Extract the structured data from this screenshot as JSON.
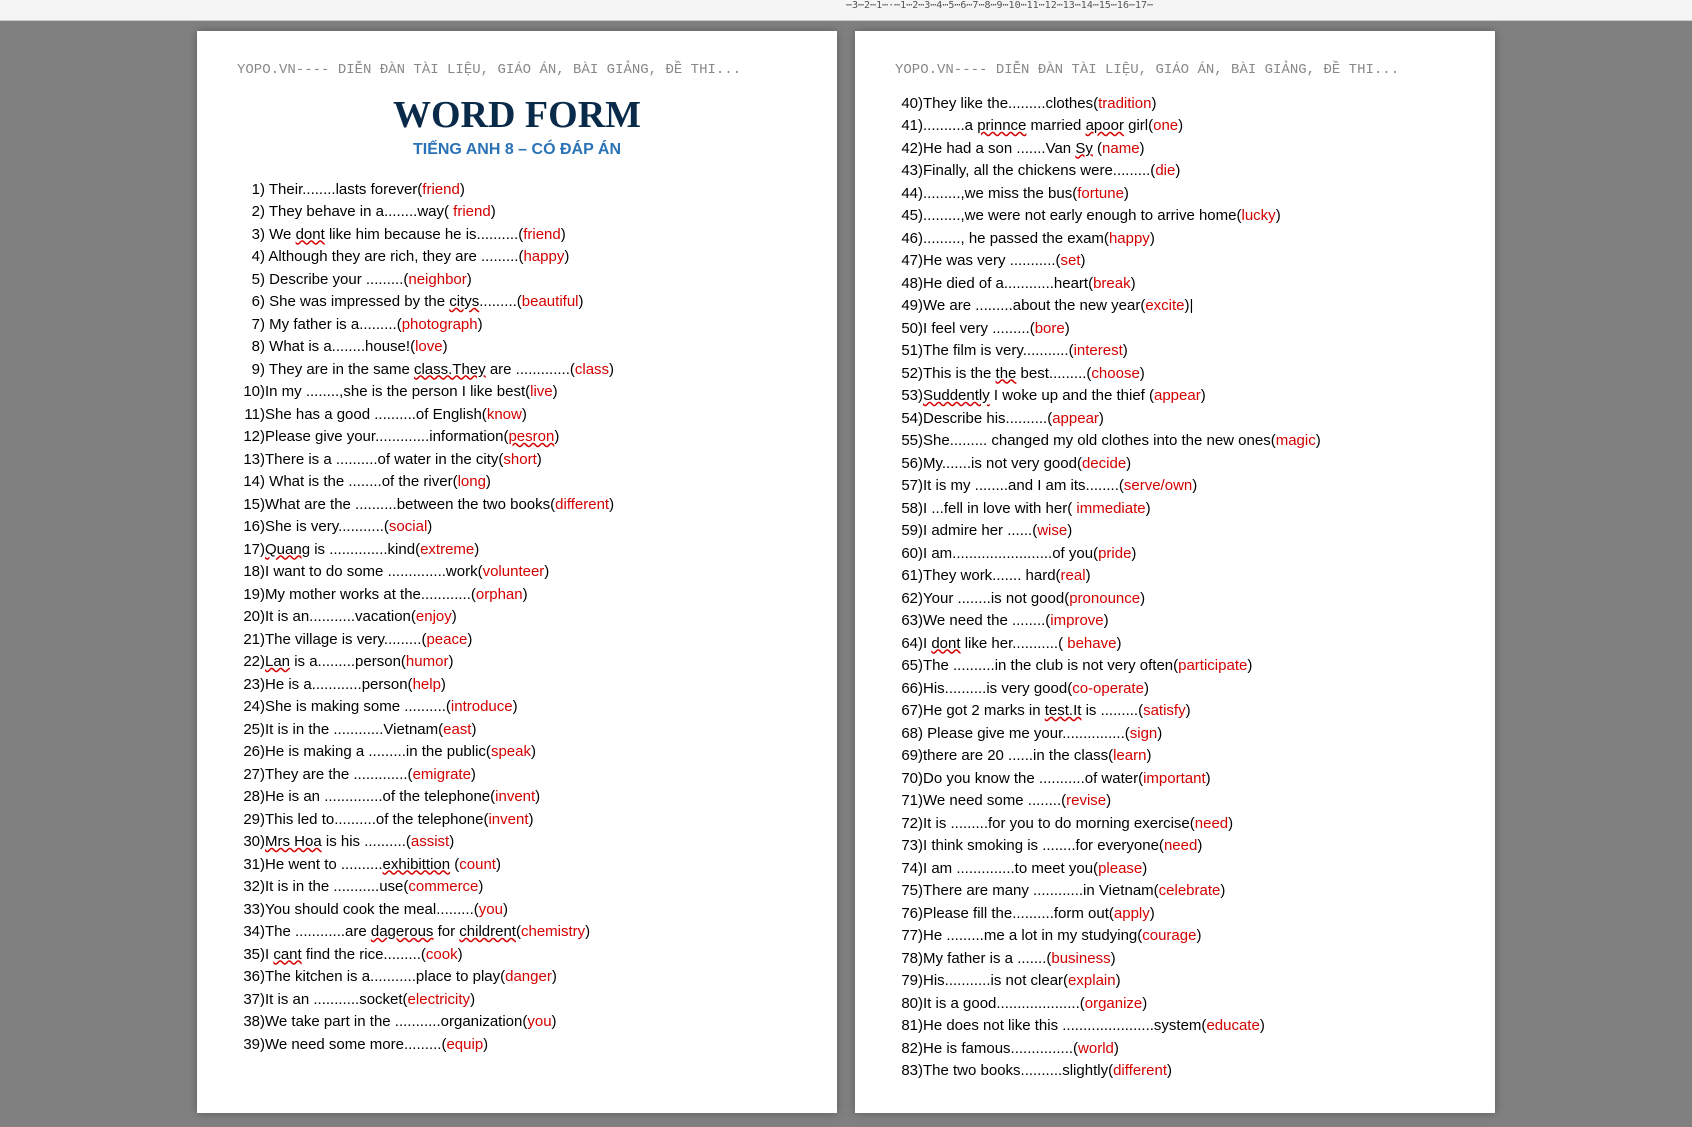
{
  "ruler_text": "⋯3⋯2⋯1⋯·⋯1⋯2⋯3⋯4⋯5⋯6⋯7⋯8⋯9⋯10⋯11⋯12⋯13⋯14⋯15⋯16⋯17⋯",
  "header": "YOPO.VN---- DIỄN ĐÀN TÀI LIỆU, GIÁO ÁN, BÀI GIẢNG, ĐỀ THI...",
  "title": "WORD FORM",
  "subtitle": "TIẾNG ANH 8 – CÓ ĐÁP ÁN",
  "page1_start": 1,
  "page1_items": [
    {
      "pre": " Their........lasts forever(",
      "ans": "friend",
      "post": ")",
      "wavy": []
    },
    {
      "pre": " They behave in a........way( ",
      "ans": "friend",
      "post": ")",
      "wavy": []
    },
    {
      "pre": " We ",
      "w": "dont",
      "pre2": " like  him because he is..........(",
      "ans": "friend",
      "post": ")",
      "wavy": [
        "dont"
      ]
    },
    {
      "pre": " Although they are rich, they are .........(",
      "ans": "happy",
      "post": ")",
      "wavy": []
    },
    {
      "pre": " Describe your .........(",
      "ans": "neighbor",
      "post": ")",
      "wavy": []
    },
    {
      "pre": " She was impressed by the ",
      "w": "citys",
      "pre2": ".........(",
      "ans": "beautiful",
      "post": ")",
      "wavy": [
        "citys"
      ]
    },
    {
      "pre": " My father is a.........(",
      "ans": "photograph",
      "post": ")",
      "wavy": []
    },
    {
      "pre": " What is a........house!(",
      "ans": "love",
      "post": ")",
      "wavy": []
    },
    {
      "pre": " They are in the same ",
      "w": "class.They",
      "pre2": " are .............(",
      "ans": "class",
      "post": ")",
      "wavy": [
        "class.They"
      ]
    },
    {
      "pre": "In my ........,she is the person I like best(",
      "ans": "live",
      "post": ")",
      "wavy": []
    },
    {
      "pre": "She has a good ..........of English(",
      "ans": "know",
      "post": ")",
      "wavy": []
    },
    {
      "pre": "Please give your.............information(",
      "ans": "pesron",
      "post": ")",
      "wavy": [
        "pesron"
      ]
    },
    {
      "pre": "There is a ..........of water in the city(",
      "ans": "short",
      "post": ")",
      "wavy": []
    },
    {
      "pre": " What is the ........of the river(",
      "ans": "long",
      "post": ")",
      "wavy": []
    },
    {
      "pre": "What are the ..........between the two books(",
      "ans": "different",
      "post": ")",
      "wavy": []
    },
    {
      "pre": "She is very...........(",
      "ans": "social",
      "post": ")",
      "wavy": []
    },
    {
      "pre": "",
      "w": "Quang",
      "pre2": " is ..............kind(",
      "ans": "extreme",
      "post": ")",
      "wavy": [
        "Quang"
      ]
    },
    {
      "pre": "I want to do some ..............work(",
      "ans": "volunteer",
      "post": ")",
      "wavy": []
    },
    {
      "pre": "My mother works at the............(",
      "ans": "orphan",
      "post": ")",
      "wavy": []
    },
    {
      "pre": "It is an...........vacation(",
      "ans": "enjoy",
      "post": ")",
      "wavy": []
    },
    {
      "pre": "The village is very.........(",
      "ans": "peace",
      "post": ")",
      "wavy": []
    },
    {
      "pre": "",
      "w": "Lan",
      "pre2": " is a.........person(",
      "ans": "humor",
      "post": ")",
      "wavy": [
        "Lan"
      ]
    },
    {
      "pre": "He is a............person(",
      "ans": "help",
      "post": ")",
      "wavy": []
    },
    {
      "pre": "She is making some ..........(",
      "ans": "introduce",
      "post": ")",
      "wavy": []
    },
    {
      "pre": "It is in the ............Vietnam(",
      "ans": "east",
      "post": ")",
      "wavy": []
    },
    {
      "pre": "He is making a .........in  the public(",
      "ans": "speak",
      "post": ")",
      "wavy": []
    },
    {
      "pre": "They are  the .............(",
      "ans": "emigrate",
      "post": ")",
      "wavy": []
    },
    {
      "pre": "He is an ..............of the telephone(",
      "ans": "invent",
      "post": ")",
      "wavy": []
    },
    {
      "pre": "This led  to..........of the telephone(",
      "ans": "invent",
      "post": ")",
      "wavy": []
    },
    {
      "pre": "",
      "w": "Mrs Hoa",
      "pre2": " is his ..........(",
      "ans": "assist",
      "post": ")",
      "wavy": [
        "Mrs Hoa"
      ]
    },
    {
      "pre": "He went to ..........",
      "w": "exhibittion",
      "pre2": " (",
      "ans": "count",
      "post": ")",
      "wavy": [
        "exhibittion"
      ]
    },
    {
      "pre": "It is in the ...........use(",
      "ans": "commerce",
      "post": ")",
      "wavy": []
    },
    {
      "pre": "You should cook the meal.........(",
      "ans": "you",
      "post": ")",
      "wavy": []
    },
    {
      "pre": "The ............are ",
      "w": "dagerous",
      "pre2": " for ",
      "w2": "childrent",
      "pre3": "(",
      "ans": "chemistry",
      "post": ")",
      "wavy": [
        "dagerous",
        "childrent"
      ]
    },
    {
      "pre": "I ",
      "w": "cant",
      "pre2": " find the rice.........(",
      "ans": "cook",
      "post": ")",
      "wavy": [
        "cant"
      ]
    },
    {
      "pre": "The kitchen is a...........place to play(",
      "ans": "danger",
      "post": ")",
      "wavy": []
    },
    {
      "pre": "It is an ...........socket(",
      "ans": "electricity",
      "post": ")",
      "wavy": []
    },
    {
      "pre": "We take part in the ...........organization(",
      "ans": "you",
      "post": ")",
      "wavy": []
    },
    {
      "pre": "We need some more.........(",
      "ans": "equip",
      "post": ")",
      "wavy": []
    }
  ],
  "page2_start": 40,
  "page2_items": [
    {
      "pre": "They like the.........clothes(",
      "ans": "tradition",
      "post": ")",
      "wavy": []
    },
    {
      "pre": "..........a ",
      "w": "prinnce",
      "pre2": " married ",
      "w2": "apoor",
      "pre3": " girl(",
      "ans": "one",
      "post": ")",
      "wavy": [
        "prinnce",
        "apoor"
      ]
    },
    {
      "pre": "He had a son .......Van ",
      "w": "Sy",
      "pre2": " (",
      "ans": "name",
      "post": ")",
      "wavy": [
        "Sy"
      ]
    },
    {
      "pre": "Finally, all the chickens were.........(",
      "ans": "die",
      "post": ")",
      "wavy": []
    },
    {
      "pre": ".........,we miss the bus(",
      "ans": "fortune",
      "post": ")",
      "wavy": []
    },
    {
      "pre": ".........,we were not early enough to arrive home(",
      "ans": "lucky",
      "post": ")",
      "wavy": []
    },
    {
      "pre": "........., he passed the exam(",
      "ans": "happy",
      "post": ")",
      "wavy": []
    },
    {
      "pre": "He was very ...........(",
      "ans": "set",
      "post": ")",
      "wavy": []
    },
    {
      "pre": "He died of a............heart(",
      "ans": "break",
      "post": ")",
      "wavy": []
    },
    {
      "pre": "We are .........about the new year(",
      "ans": "excite",
      "post": ")|",
      "wavy": []
    },
    {
      "pre": "I feel very .........(",
      "ans": "bore",
      "post": ")",
      "wavy": []
    },
    {
      "pre": "The film is very...........(",
      "ans": "interest",
      "post": ")",
      "wavy": []
    },
    {
      "pre": "This is the ",
      "w": "the",
      "pre2": " best.........(",
      "ans": "choose",
      "post": ")",
      "wavy": [
        "the"
      ]
    },
    {
      "pre": "",
      "w": "Suddently",
      "pre2": " I woke up and the thief (",
      "ans": "appear",
      "post": ")",
      "wavy": [
        "Suddently"
      ]
    },
    {
      "pre": "Describe his..........(",
      "ans": "appear",
      "post": ")",
      "wavy": []
    },
    {
      "pre": "She......... changed my old clothes into the new ones(",
      "ans": "magic",
      "post": ")",
      "wavy": []
    },
    {
      "pre": "My.......is not very good(",
      "ans": "decide",
      "post": ")",
      "wavy": []
    },
    {
      "pre": "It is my ........and I am its........(",
      "ans": "serve/own",
      "post": ")",
      "wavy": []
    },
    {
      "pre": "I ...fell in love with her( ",
      "ans": "immediate",
      "post": ")",
      "wavy": []
    },
    {
      "pre": "I admire her ......(",
      "ans": "wise",
      "post": ")",
      "wavy": []
    },
    {
      "pre": "I am........................of you(",
      "ans": "pride",
      "post": ")",
      "wavy": []
    },
    {
      "pre": "They work....... hard(",
      "ans": "real",
      "post": ")",
      "wavy": []
    },
    {
      "pre": "Your ........is not good(",
      "ans": "pronounce",
      "post": ")",
      "wavy": []
    },
    {
      "pre": "We need the ........(",
      "ans": "improve",
      "post": ")",
      "wavy": []
    },
    {
      "pre": "I ",
      "w": "dont",
      "pre2": " like her...........( ",
      "ans": "behave",
      "post": ")",
      "wavy": [
        "dont"
      ]
    },
    {
      "pre": "The ..........in the club is not very often(",
      "ans": "participate",
      "post": ")",
      "wavy": []
    },
    {
      "pre": "His..........is very good(",
      "ans": "co-operate",
      "post": ")",
      "wavy": []
    },
    {
      "pre": "He got 2 marks in ",
      "w": "test.It",
      "pre2": " is .........(",
      "ans": "satisfy",
      "post": ")",
      "wavy": [
        "test.It"
      ]
    },
    {
      "pre": " Please give me your...............(",
      "ans": "sign",
      "post": ")",
      "wavy": []
    },
    {
      "pre": "there are 20 ......in the class(",
      "ans": "learn",
      "post": ")",
      "wavy": []
    },
    {
      "pre": "Do you know the ...........of water(",
      "ans": "important",
      "post": ")",
      "wavy": []
    },
    {
      "pre": "We need some ........(",
      "ans": "revise",
      "post": ")",
      "wavy": []
    },
    {
      "pre": "It is .........for you to do morning exercise(",
      "ans": "need",
      "post": ")",
      "wavy": []
    },
    {
      "pre": "I think smoking is ........for everyone(",
      "ans": "need",
      "post": ")",
      "wavy": []
    },
    {
      "pre": "I am ..............to meet you(",
      "ans": "please",
      "post": ")",
      "wavy": []
    },
    {
      "pre": "There are many ............in Vietnam(",
      "ans": "celebrate",
      "post": ")",
      "wavy": []
    },
    {
      "pre": "Please fill the..........form out(",
      "ans": "apply",
      "post": ")",
      "wavy": []
    },
    {
      "pre": "He .........me a lot in my studying(",
      "ans": "courage",
      "post": ")",
      "wavy": []
    },
    {
      "pre": "My father is a .......(",
      "ans": "business",
      "post": ")",
      "wavy": []
    },
    {
      "pre": "His...........is not clear(",
      "ans": "explain",
      "post": ")",
      "wavy": []
    },
    {
      "pre": "It is a good....................(",
      "ans": "organize",
      "post": ")",
      "wavy": []
    },
    {
      "pre": "He does not like this ......................system(",
      "ans": "educate",
      "post": ")",
      "wavy": []
    },
    {
      "pre": "He is famous...............(",
      "ans": "world",
      "post": ")",
      "wavy": []
    },
    {
      "pre": "The two books..........slightly(",
      "ans": "different",
      "post": ")",
      "wavy": []
    }
  ]
}
